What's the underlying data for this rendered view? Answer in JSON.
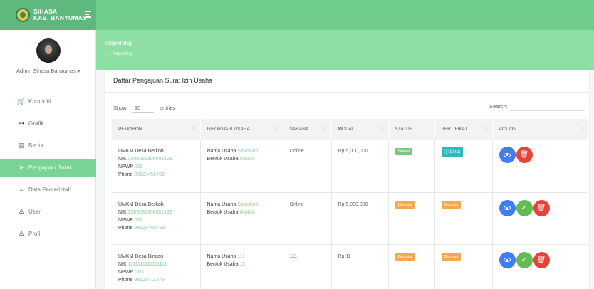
{
  "brand": {
    "line1": "SIHASA",
    "line2": "KAB. BANYUMAS"
  },
  "sidebar": {
    "user": "Admin Sihasa Banyumas",
    "user_caret": "▾",
    "items": [
      {
        "label": "Komoditi",
        "icon": "cart-icon",
        "glyph": "🛒",
        "active": false
      },
      {
        "label": "Grafik",
        "icon": "chart-icon",
        "glyph": "⊶",
        "active": false
      },
      {
        "label": "Berita",
        "icon": "document-icon",
        "glyph": "▤",
        "active": false
      },
      {
        "label": "Pengajuan Surat",
        "icon": "paper-plane-icon",
        "glyph": "➤",
        "active": true
      },
      {
        "label": "Data Pemerintah",
        "icon": "database-icon",
        "glyph": "≡",
        "active": false
      },
      {
        "label": "User",
        "icon": "user-icon",
        "glyph": "♙",
        "active": false
      },
      {
        "label": "Profil",
        "icon": "profile-icon",
        "glyph": "♙",
        "active": false
      }
    ]
  },
  "header": {
    "title": "Reporting",
    "home_glyph": "⌂",
    "crumb_sep": "/",
    "crumb": "Reporting"
  },
  "card": {
    "title": "Daftar Pengajuan Surat Izin Usaha",
    "show_label": "Show",
    "show_value": "10",
    "entries_label": "entries",
    "search_label": "Search:",
    "search_value": ""
  },
  "table": {
    "headers": [
      "PEMOHON",
      "INFORMASI USAHA",
      "SARANA",
      "MODAL",
      "STATUS",
      "SERTIFIKAT",
      "ACTION"
    ],
    "sort_glyphs": [
      "↑↓",
      "↑↓",
      "↑↓",
      "↑↓",
      "↑↓",
      "↑↓",
      "↑↓"
    ],
    "labels": {
      "nik": "NIK",
      "npwp": "NPWP",
      "phone": "Phone",
      "nama_usaha": "Nama Usaha",
      "bentuk_usaha": "Bentuk Usaha"
    },
    "rows": [
      {
        "pemohon": "UMKM Desa Berkoh",
        "nik": "3209281306002133",
        "npwp": "000",
        "phone": "08123456789",
        "nama_usaha": "Sataskop",
        "bentuk_usaha": "UMKM",
        "sarana": "Online",
        "modal": "Rp 5,000,000",
        "status": "Selesai",
        "status_color": "#79c77f",
        "sertifikat": "Lihat",
        "sertifikat_glyph": "ⓘ"
      },
      {
        "pemohon": "UMKM Desa Berkoh",
        "nik": "3209281306002133",
        "npwp": "000",
        "phone": "08123456789",
        "nama_usaha": "Sataskop",
        "bentuk_usaha": "UMKM",
        "sarana": "Online",
        "modal": "Rp 5,000,000",
        "status": "Diproses",
        "status_color": "#f4a84f",
        "sertifikat": "Diproses"
      },
      {
        "pemohon": "UMKM Desa Bincau",
        "nik": "1111111111111111",
        "npwp": "1111",
        "phone": "08121411373",
        "nama_usaha": "111",
        "bentuk_usaha": "11",
        "sarana": "111",
        "modal": "Rp 11",
        "status": "Diproses",
        "status_color": "#f4a84f",
        "sertifikat": "Diproses"
      }
    ],
    "action_glyphs": {
      "approve": "✓",
      "delete": "🗑"
    }
  }
}
